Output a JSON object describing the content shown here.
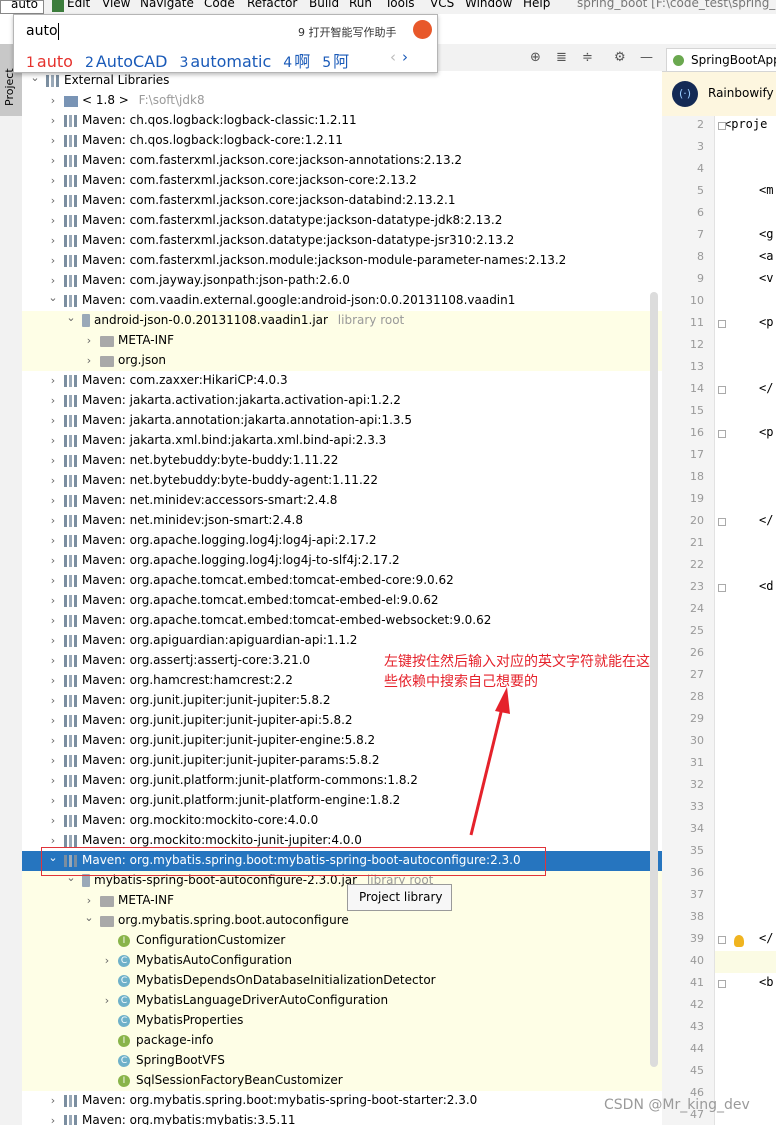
{
  "menubar": {
    "typed": "auto",
    "items": [
      "Edit",
      "View",
      "Navigate",
      "Code",
      "Refactor",
      "Build",
      "Run",
      "Tools",
      "VCS",
      "Window",
      "Help"
    ],
    "window_title": "spring_boot [F:\\code_test\\spring_b"
  },
  "ime": {
    "input": "auto",
    "assist": "9 打开智能写作助手",
    "candidates": [
      {
        "n": "1",
        "text": "auto"
      },
      {
        "n": "2",
        "text": "AutoCAD"
      },
      {
        "n": "3",
        "text": "automatic"
      },
      {
        "n": "4",
        "text": "啊"
      },
      {
        "n": "5",
        "text": "阿"
      }
    ],
    "prev": "‹",
    "next": "›"
  },
  "toolstrip": {
    "project_tab": "Project"
  },
  "tree": {
    "rows": [
      {
        "label": "External Libraries",
        "indent": 0,
        "arrow": "down",
        "icon": "lib",
        "style": ""
      },
      {
        "label": "< 1.8 >",
        "extra": "F:\\soft\\jdk8",
        "indent": 1,
        "arrow": "right",
        "icon": "sdk",
        "style": ""
      },
      {
        "label": "Maven: ch.qos.logback:logback-classic:1.2.11",
        "indent": 1,
        "arrow": "right",
        "icon": "lib",
        "style": ""
      },
      {
        "label": "Maven: ch.qos.logback:logback-core:1.2.11",
        "indent": 1,
        "arrow": "right",
        "icon": "lib",
        "style": ""
      },
      {
        "label": "Maven: com.fasterxml.jackson.core:jackson-annotations:2.13.2",
        "indent": 1,
        "arrow": "right",
        "icon": "lib",
        "style": ""
      },
      {
        "label": "Maven: com.fasterxml.jackson.core:jackson-core:2.13.2",
        "indent": 1,
        "arrow": "right",
        "icon": "lib",
        "style": ""
      },
      {
        "label": "Maven: com.fasterxml.jackson.core:jackson-databind:2.13.2.1",
        "indent": 1,
        "arrow": "right",
        "icon": "lib",
        "style": ""
      },
      {
        "label": "Maven: com.fasterxml.jackson.datatype:jackson-datatype-jdk8:2.13.2",
        "indent": 1,
        "arrow": "right",
        "icon": "lib",
        "style": ""
      },
      {
        "label": "Maven: com.fasterxml.jackson.datatype:jackson-datatype-jsr310:2.13.2",
        "indent": 1,
        "arrow": "right",
        "icon": "lib",
        "style": ""
      },
      {
        "label": "Maven: com.fasterxml.jackson.module:jackson-module-parameter-names:2.13.2",
        "indent": 1,
        "arrow": "right",
        "icon": "lib",
        "style": ""
      },
      {
        "label": "Maven: com.jayway.jsonpath:json-path:2.6.0",
        "indent": 1,
        "arrow": "right",
        "icon": "lib",
        "style": ""
      },
      {
        "label": "Maven: com.vaadin.external.google:android-json:0.0.20131108.vaadin1",
        "indent": 1,
        "arrow": "down",
        "icon": "lib",
        "style": ""
      },
      {
        "label": "android-json-0.0.20131108.vaadin1.jar",
        "extra": "library root",
        "indent": 2,
        "arrow": "down",
        "icon": "jar",
        "style": "lib"
      },
      {
        "label": "META-INF",
        "indent": 3,
        "arrow": "right",
        "icon": "folder",
        "style": "lib"
      },
      {
        "label": "org.json",
        "indent": 3,
        "arrow": "right",
        "icon": "pkg",
        "style": "lib"
      },
      {
        "label": "Maven: com.zaxxer:HikariCP:4.0.3",
        "indent": 1,
        "arrow": "right",
        "icon": "lib",
        "style": ""
      },
      {
        "label": "Maven: jakarta.activation:jakarta.activation-api:1.2.2",
        "indent": 1,
        "arrow": "right",
        "icon": "lib",
        "style": ""
      },
      {
        "label": "Maven: jakarta.annotation:jakarta.annotation-api:1.3.5",
        "indent": 1,
        "arrow": "right",
        "icon": "lib",
        "style": ""
      },
      {
        "label": "Maven: jakarta.xml.bind:jakarta.xml.bind-api:2.3.3",
        "indent": 1,
        "arrow": "right",
        "icon": "lib",
        "style": ""
      },
      {
        "label": "Maven: net.bytebuddy:byte-buddy:1.11.22",
        "indent": 1,
        "arrow": "right",
        "icon": "lib",
        "style": ""
      },
      {
        "label": "Maven: net.bytebuddy:byte-buddy-agent:1.11.22",
        "indent": 1,
        "arrow": "right",
        "icon": "lib",
        "style": ""
      },
      {
        "label": "Maven: net.minidev:accessors-smart:2.4.8",
        "indent": 1,
        "arrow": "right",
        "icon": "lib",
        "style": ""
      },
      {
        "label": "Maven: net.minidev:json-smart:2.4.8",
        "indent": 1,
        "arrow": "right",
        "icon": "lib",
        "style": ""
      },
      {
        "label": "Maven: org.apache.logging.log4j:log4j-api:2.17.2",
        "indent": 1,
        "arrow": "right",
        "icon": "lib",
        "style": ""
      },
      {
        "label": "Maven: org.apache.logging.log4j:log4j-to-slf4j:2.17.2",
        "indent": 1,
        "arrow": "right",
        "icon": "lib",
        "style": ""
      },
      {
        "label": "Maven: org.apache.tomcat.embed:tomcat-embed-core:9.0.62",
        "indent": 1,
        "arrow": "right",
        "icon": "lib",
        "style": ""
      },
      {
        "label": "Maven: org.apache.tomcat.embed:tomcat-embed-el:9.0.62",
        "indent": 1,
        "arrow": "right",
        "icon": "lib",
        "style": ""
      },
      {
        "label": "Maven: org.apache.tomcat.embed:tomcat-embed-websocket:9.0.62",
        "indent": 1,
        "arrow": "right",
        "icon": "lib",
        "style": ""
      },
      {
        "label": "Maven: org.apiguardian:apiguardian-api:1.1.2",
        "indent": 1,
        "arrow": "right",
        "icon": "lib",
        "style": ""
      },
      {
        "label": "Maven: org.assertj:assertj-core:3.21.0",
        "indent": 1,
        "arrow": "right",
        "icon": "lib",
        "style": ""
      },
      {
        "label": "Maven: org.hamcrest:hamcrest:2.2",
        "indent": 1,
        "arrow": "right",
        "icon": "lib",
        "style": ""
      },
      {
        "label": "Maven: org.junit.jupiter:junit-jupiter:5.8.2",
        "indent": 1,
        "arrow": "right",
        "icon": "lib",
        "style": ""
      },
      {
        "label": "Maven: org.junit.jupiter:junit-jupiter-api:5.8.2",
        "indent": 1,
        "arrow": "right",
        "icon": "lib",
        "style": ""
      },
      {
        "label": "Maven: org.junit.jupiter:junit-jupiter-engine:5.8.2",
        "indent": 1,
        "arrow": "right",
        "icon": "lib",
        "style": ""
      },
      {
        "label": "Maven: org.junit.jupiter:junit-jupiter-params:5.8.2",
        "indent": 1,
        "arrow": "right",
        "icon": "lib",
        "style": ""
      },
      {
        "label": "Maven: org.junit.platform:junit-platform-commons:1.8.2",
        "indent": 1,
        "arrow": "right",
        "icon": "lib",
        "style": ""
      },
      {
        "label": "Maven: org.junit.platform:junit-platform-engine:1.8.2",
        "indent": 1,
        "arrow": "right",
        "icon": "lib",
        "style": ""
      },
      {
        "label": "Maven: org.mockito:mockito-core:4.0.0",
        "indent": 1,
        "arrow": "right",
        "icon": "lib",
        "style": ""
      },
      {
        "label": "Maven: org.mockito:mockito-junit-jupiter:4.0.0",
        "indent": 1,
        "arrow": "right",
        "icon": "lib",
        "style": ""
      },
      {
        "label": "Maven: org.mybatis.spring.boot:mybatis-spring-boot-autoconfigure:2.3.0",
        "indent": 1,
        "arrow": "down",
        "icon": "lib",
        "style": "sel"
      },
      {
        "label": "mybatis-spring-boot-autoconfigure-2.3.0.jar",
        "extra": "library root",
        "indent": 2,
        "arrow": "down",
        "icon": "jar",
        "style": "lib"
      },
      {
        "label": "META-INF",
        "indent": 3,
        "arrow": "right",
        "icon": "folder",
        "style": "lib"
      },
      {
        "label": "org.mybatis.spring.boot.autoconfigure",
        "indent": 3,
        "arrow": "down",
        "icon": "pkg",
        "style": "lib"
      },
      {
        "label": "ConfigurationCustomizer",
        "indent": 4,
        "arrow": "",
        "icon": "intf",
        "style": "lib"
      },
      {
        "label": "MybatisAutoConfiguration",
        "indent": 4,
        "arrow": "right",
        "icon": "class",
        "style": "lib"
      },
      {
        "label": "MybatisDependsOnDatabaseInitializationDetector",
        "indent": 4,
        "arrow": "",
        "icon": "class",
        "style": "lib"
      },
      {
        "label": "MybatisLanguageDriverAutoConfiguration",
        "indent": 4,
        "arrow": "right",
        "icon": "class",
        "style": "lib"
      },
      {
        "label": "MybatisProperties",
        "indent": 4,
        "arrow": "",
        "icon": "class",
        "style": "lib"
      },
      {
        "label": "package-info",
        "indent": 4,
        "arrow": "",
        "icon": "intf",
        "style": "lib"
      },
      {
        "label": "SpringBootVFS",
        "indent": 4,
        "arrow": "",
        "icon": "class",
        "style": "lib"
      },
      {
        "label": "SqlSessionFactoryBeanCustomizer",
        "indent": 4,
        "arrow": "",
        "icon": "intf",
        "style": "lib"
      },
      {
        "label": "Maven: org.mybatis.spring.boot:mybatis-spring-boot-starter:2.3.0",
        "indent": 1,
        "arrow": "right",
        "icon": "lib",
        "style": ""
      },
      {
        "label": "Maven: org.mybatis:mybatis:3.5.11",
        "indent": 1,
        "arrow": "right",
        "icon": "lib",
        "style": ""
      }
    ]
  },
  "tooltip": "Project library",
  "annotation": "左键按住然后输入对应的英文字符就能在这些依赖中搜索自己想要的",
  "editor": {
    "tab": "SpringBootApp",
    "plugin": "Rainbowify",
    "plugin_logo": "(·)",
    "line_numbers": [
      "2",
      "3",
      "4",
      "5",
      "6",
      "7",
      "8",
      "9",
      "10",
      "11",
      "12",
      "13",
      "14",
      "15",
      "16",
      "17",
      "18",
      "19",
      "20",
      "21",
      "22",
      "23",
      "24",
      "25",
      "26",
      "27",
      "28",
      "29",
      "30",
      "31",
      "32",
      "33",
      "34",
      "35",
      "36",
      "37",
      "38",
      "39",
      "40",
      "41",
      "42",
      "43",
      "44",
      "45",
      "46",
      "47"
    ],
    "code": [
      {
        "line": "2",
        "text": "<proje"
      },
      {
        "line": "5",
        "text": "<m"
      },
      {
        "line": "7",
        "text": "<g"
      },
      {
        "line": "8",
        "text": "<a"
      },
      {
        "line": "9",
        "text": "<v"
      },
      {
        "line": "11",
        "text": "<p"
      },
      {
        "line": "14",
        "text": "</"
      },
      {
        "line": "16",
        "text": "<p"
      },
      {
        "line": "20",
        "text": "</"
      },
      {
        "line": "23",
        "text": "<d"
      },
      {
        "line": "39",
        "text": "</"
      },
      {
        "line": "41",
        "text": "<b"
      }
    ]
  },
  "watermark": "CSDN @Mr_king_dev"
}
